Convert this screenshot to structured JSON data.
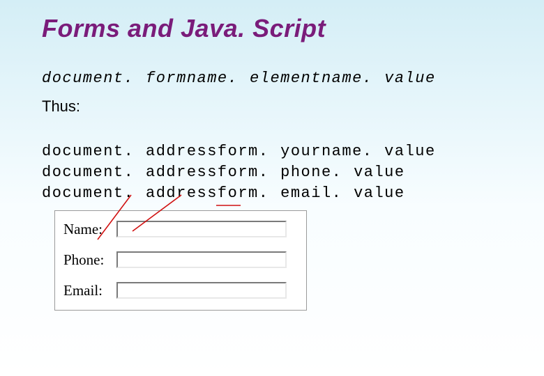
{
  "title": "Forms and Java. Script",
  "syntax": "document. formname. elementname. value",
  "thus": "Thus:",
  "code_lines": [
    "document. addressform. yourname. value",
    "document. addressform. phone. value",
    "document. addressform. email. value"
  ],
  "form": {
    "rows": [
      {
        "label": "Name:",
        "value": ""
      },
      {
        "label": "Phone:",
        "value": ""
      },
      {
        "label": "Email:",
        "value": ""
      }
    ]
  },
  "colors": {
    "title": "#7a1c7a",
    "connector": "#d01010"
  }
}
